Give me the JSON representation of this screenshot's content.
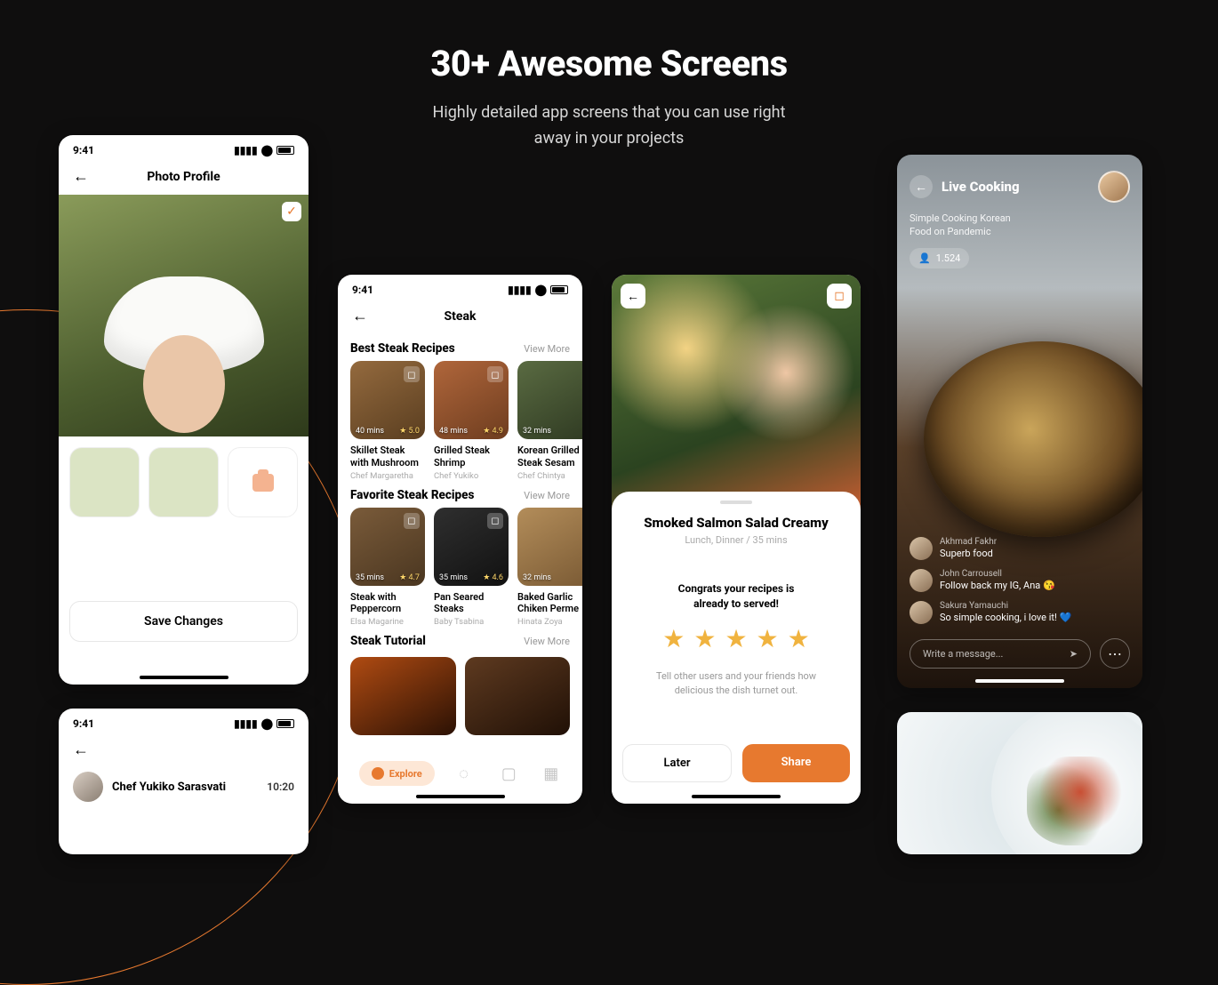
{
  "header": {
    "title": "30+ Awesome Screens",
    "subtitle_line1": "Highly detailed app screens that you can use right",
    "subtitle_line2": "away in your projects"
  },
  "status": {
    "time": "9:41"
  },
  "screen1": {
    "title": "Photo Profile",
    "save": "Save Changes"
  },
  "screen1b": {
    "chef": "Chef Yukiko Sarasvati",
    "time": "10:20"
  },
  "screen2": {
    "title": "Steak",
    "sections": {
      "best": {
        "name": "Best Steak Recipes",
        "more": "View More"
      },
      "fav": {
        "name": "Favorite Steak Recipes",
        "more": "View More"
      },
      "tut": {
        "name": "Steak Tutorial",
        "more": "View More"
      }
    },
    "best": [
      {
        "mins": "40 mins",
        "rating": "5.0",
        "title": "Skillet Steak with Mushroom",
        "chef": "Chef Margaretha"
      },
      {
        "mins": "48 mins",
        "rating": "4.9",
        "title": "Grilled Steak Shrimp",
        "chef": "Chef Yukiko"
      },
      {
        "mins": "32 mins",
        "rating": "",
        "title": "Korean Grilled Steak Sesam",
        "chef": "Chef Chintya"
      }
    ],
    "fav": [
      {
        "mins": "35 mins",
        "rating": "4.7",
        "title": "Steak with Peppercorn",
        "chef": "Elsa Magarine"
      },
      {
        "mins": "35 mins",
        "rating": "4.6",
        "title": "Pan Seared Steaks",
        "chef": "Baby Tsabina"
      },
      {
        "mins": "32 mins",
        "rating": "",
        "title": "Baked Garlic Chiken Perme",
        "chef": "Hinata Zoya"
      }
    ],
    "nav": {
      "explore": "Explore"
    }
  },
  "screen3": {
    "dish": "Smoked Salmon Salad Creamy",
    "meta": "Lunch, Dinner / 35 mins",
    "congrats_l1": "Congrats your recipes is",
    "congrats_l2": "already to served!",
    "tell": "Tell other users and your friends how delicious the dish turnet out.",
    "later": "Later",
    "share": "Share"
  },
  "screen4": {
    "title": "Live Cooking",
    "subtitle": "Simple Cooking Korean Food on Pandemic",
    "viewers": "1.524",
    "chats": [
      {
        "name": "Akhmad Fakhr",
        "msg": "Superb food"
      },
      {
        "name": "John Carrousell",
        "msg": "Follow back my IG, Ana 😘"
      },
      {
        "name": "Sakura Yamauchi",
        "msg": "So simple cooking, i love it! 💙"
      }
    ],
    "compose_placeholder": "Write a message..."
  }
}
